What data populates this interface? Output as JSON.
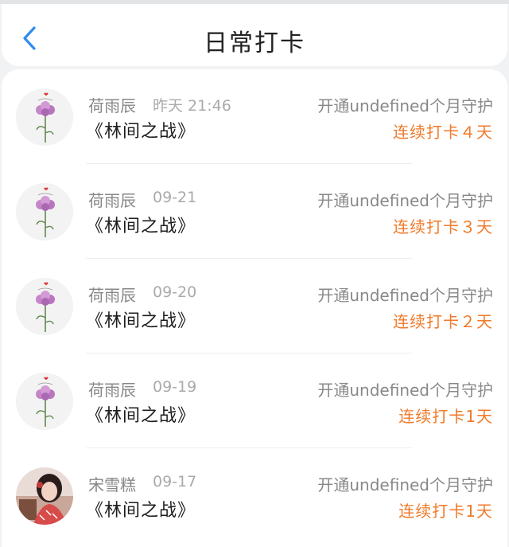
{
  "header": {
    "title": "日常打卡",
    "back_icon": "chevron-left-icon"
  },
  "colors": {
    "accent": "#2f8cf0",
    "streak": "#f07a2a",
    "muted": "#888888"
  },
  "records": [
    {
      "name": "荷雨辰",
      "time": "昨天 21:46",
      "book": "《林间之战》",
      "guard": "开通undefined个月守护",
      "streak": "连续打卡４天",
      "avatar": "carnation-avatar"
    },
    {
      "name": "荷雨辰",
      "time": "09-21",
      "book": "《林间之战》",
      "guard": "开通undefined个月守护",
      "streak": "连续打卡３天",
      "avatar": "carnation-avatar"
    },
    {
      "name": "荷雨辰",
      "time": "09-20",
      "book": "《林间之战》",
      "guard": "开通undefined个月守护",
      "streak": "连续打卡２天",
      "avatar": "carnation-avatar"
    },
    {
      "name": "荷雨辰",
      "time": "09-19",
      "book": "《林间之战》",
      "guard": "开通undefined个月守护",
      "streak": "连续打卡1天",
      "avatar": "carnation-avatar"
    },
    {
      "name": "宋雪糕",
      "time": "09-17",
      "book": "《林间之战》",
      "guard": "开通undefined个月守护",
      "streak": "连续打卡1天",
      "avatar": "girl-photo-avatar"
    }
  ]
}
